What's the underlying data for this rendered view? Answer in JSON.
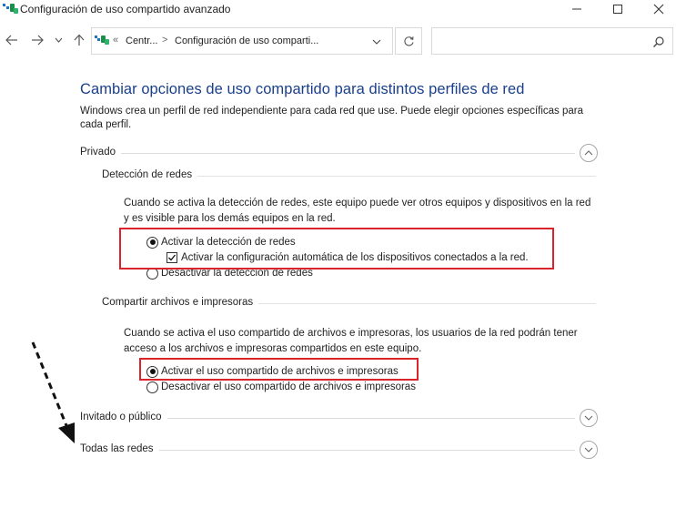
{
  "window": {
    "title": "Configuración de uso compartido avanzado",
    "icon": "network-sharing-icon",
    "controls": [
      "minimize-icon",
      "maximize-icon",
      "close-icon"
    ]
  },
  "address_bar": {
    "overflow": "«",
    "crumbs": [
      "Centr...",
      "Configuración de uso comparti..."
    ],
    "separator": ">",
    "search_placeholder": ""
  },
  "content": {
    "heading": "Cambiar opciones de uso compartido para distintos perfiles de red",
    "intro": "Windows crea un perfil de red independiente para cada red que use. Puede elegir opciones específicas para cada perfil.",
    "profiles": [
      {
        "label": "Privado",
        "expanded": true,
        "subsections": [
          {
            "label": "Detección de redes",
            "description": "Cuando se activa la detección de redes, este equipo puede ver otros equipos y dispositivos en la red y es visible para los demás equipos en la red.",
            "options": [
              {
                "type": "radio",
                "label": "Activar la detección de redes",
                "selected": true
              },
              {
                "type": "checkbox",
                "label": "Activar la configuración automática de los dispositivos conectados a la red.",
                "checked": true
              },
              {
                "type": "radio",
                "label": "Desactivar la detección de redes",
                "selected": false
              }
            ]
          },
          {
            "label": "Compartir archivos e impresoras",
            "description": "Cuando se activa el uso compartido de archivos e impresoras, los usuarios de la red podrán tener acceso a los archivos e impresoras compartidos en este equipo.",
            "options": [
              {
                "type": "radio",
                "label": "Activar el uso compartido de archivos e impresoras",
                "selected": true
              },
              {
                "type": "radio",
                "label": "Desactivar el uso compartido de archivos e impresoras",
                "selected": false
              }
            ]
          }
        ]
      },
      {
        "label": "Invitado o público",
        "expanded": false
      },
      {
        "label": "Todas las redes",
        "expanded": false
      }
    ]
  },
  "annotations": {
    "highlight_color": "#d9242b",
    "arrow_color": "#111111"
  },
  "colors": {
    "heading": "#1a3f8a",
    "icon_accent": "#1a8f4a"
  }
}
